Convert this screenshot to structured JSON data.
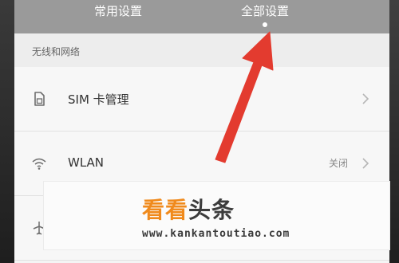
{
  "tabs": {
    "common": "常用设置",
    "all": "全部设置"
  },
  "section": {
    "title": "无线和网络"
  },
  "rows": [
    {
      "label": "SIM 卡管理",
      "value": "",
      "icon": "sim-card-icon"
    },
    {
      "label": "WLAN",
      "value": "关闭",
      "icon": "wifi-icon"
    },
    {
      "label": "",
      "value": "",
      "icon": "airplane-icon"
    }
  ],
  "watermark": {
    "brand_part1": "看看",
    "brand_part2": "头条",
    "url": "www.kankantoutiao.com"
  },
  "colors": {
    "tabbar": "#9a9a9a",
    "arrow": "#e33b2f",
    "brand_orange": "#f08a1c"
  }
}
